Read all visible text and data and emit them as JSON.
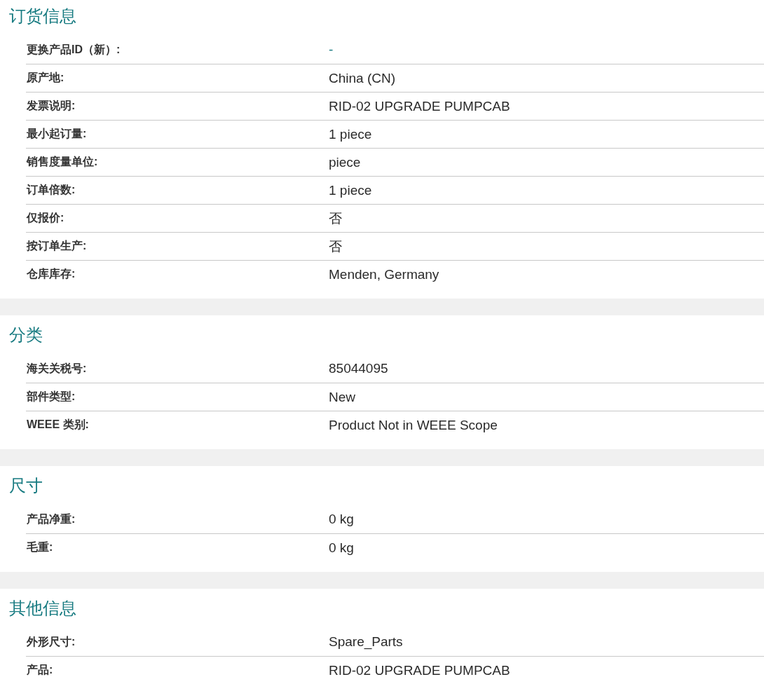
{
  "sections": [
    {
      "title": "订货信息",
      "rows": [
        {
          "label": "更换产品ID（新）:",
          "value": "-",
          "kind": "link"
        },
        {
          "label": "原产地:",
          "value": "China (CN)",
          "kind": "text"
        },
        {
          "label": "发票说明:",
          "value": "RID-02 UPGRADE PUMPCAB",
          "kind": "text"
        },
        {
          "label": "最小起订量:",
          "value": "1 piece",
          "kind": "text"
        },
        {
          "label": "销售度量单位:",
          "value": "piece",
          "kind": "text"
        },
        {
          "label": "订单倍数:",
          "value": "1 piece",
          "kind": "text"
        },
        {
          "label": "仅报价:",
          "value": "否",
          "kind": "text"
        },
        {
          "label": "按订单生产:",
          "value": "否",
          "kind": "text"
        },
        {
          "label": "仓库库存:",
          "value": "Menden, Germany",
          "kind": "text"
        }
      ]
    },
    {
      "title": "分类",
      "rows": [
        {
          "label": "海关关税号:",
          "value": "85044095",
          "kind": "text"
        },
        {
          "label": "部件类型:",
          "value": "New",
          "kind": "text"
        },
        {
          "label": "WEEE 类别:",
          "value": "Product Not in WEEE Scope",
          "kind": "text"
        }
      ]
    },
    {
      "title": "尺寸",
      "rows": [
        {
          "label": "产品净重:",
          "value": "0 kg",
          "kind": "text"
        },
        {
          "label": "毛重:",
          "value": "0 kg",
          "kind": "text"
        }
      ]
    },
    {
      "title": "其他信息",
      "rows": [
        {
          "label": "外形尺寸:",
          "value": "Spare_Parts",
          "kind": "text"
        },
        {
          "label": "产品:",
          "value": "RID-02 UPGRADE PUMPCAB",
          "kind": "text"
        }
      ]
    }
  ]
}
